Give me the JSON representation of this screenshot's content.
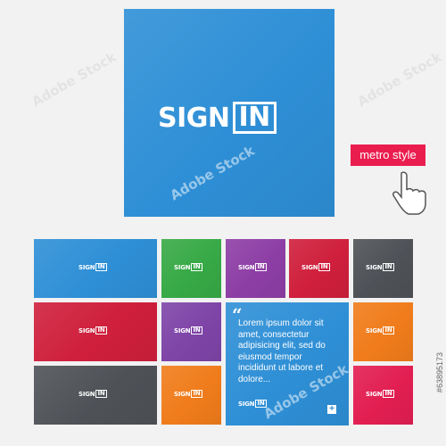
{
  "logo": {
    "word": "SIGN",
    "boxed": "IN"
  },
  "metro_style_label": "metro style",
  "quote_text": "Lorem ipsum dolor sit amet, consectetur adipisicing elit, sed do eiusmod tempor incididunt ut labore et dolore...",
  "quote_mark": "“",
  "plus": "+",
  "side_label": "#63895173",
  "watermark": "Adobe Stock",
  "colors": {
    "blue": "#2e8fd6",
    "green": "#37a946",
    "purple": "#8d3ea5",
    "crimson": "#cf1f3c",
    "gray": "#4e5257",
    "violet": "#7e44a7",
    "orange": "#f07c1b",
    "pink": "#e21e51",
    "metro_button": "#ea1d4f"
  }
}
